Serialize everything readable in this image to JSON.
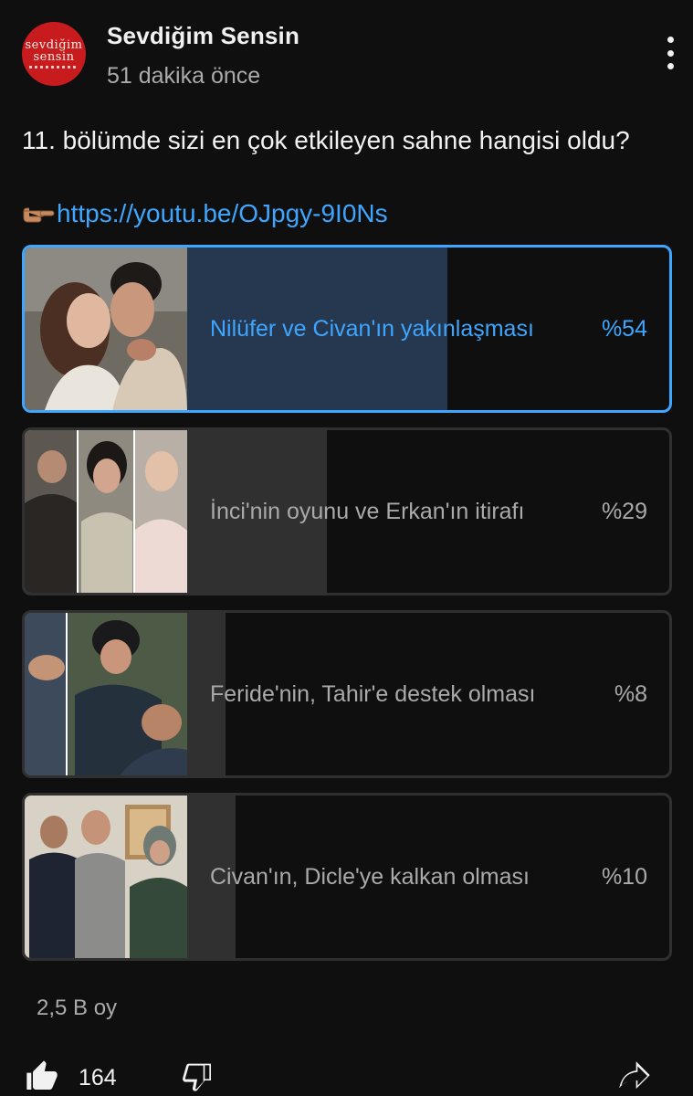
{
  "channel": {
    "name": "Sevdiğim Sensin",
    "logo_text_line1": "sevdiğim",
    "logo_text_line2": "sensin",
    "timestamp": "51 dakika önce"
  },
  "post": {
    "text": "11. bölümde sizi en çok etkileyen sahne hangisi oldu?",
    "link": "https://youtu.be/OJpgy-9I0Ns"
  },
  "poll": {
    "options": [
      {
        "label": "Nilüfer ve Civan'ın yakınlaşması",
        "percent_text": "%54",
        "percent": 54,
        "selected": true
      },
      {
        "label": "İnci'nin oyunu ve Erkan'ın itirafı",
        "percent_text": "%29",
        "percent": 29,
        "selected": false
      },
      {
        "label": "Feride'nin, Tahir'e destek olması",
        "percent_text": "%8",
        "percent": 8,
        "selected": false
      },
      {
        "label": "Civan'ın, Dicle'ye kalkan olması",
        "percent_text": "%10",
        "percent": 10,
        "selected": false
      }
    ],
    "votes": "2,5 B oy"
  },
  "actions": {
    "likes": "164"
  },
  "icons": {
    "menu": "more-vert-icon",
    "like": "thumb-up-icon",
    "dislike": "thumb-down-icon",
    "share": "share-icon",
    "hand": "pointing-hand-emoji"
  },
  "colors": {
    "accent": "#3ea6ff",
    "background": "#0f0f0f",
    "logo_red": "#c81b1e"
  }
}
